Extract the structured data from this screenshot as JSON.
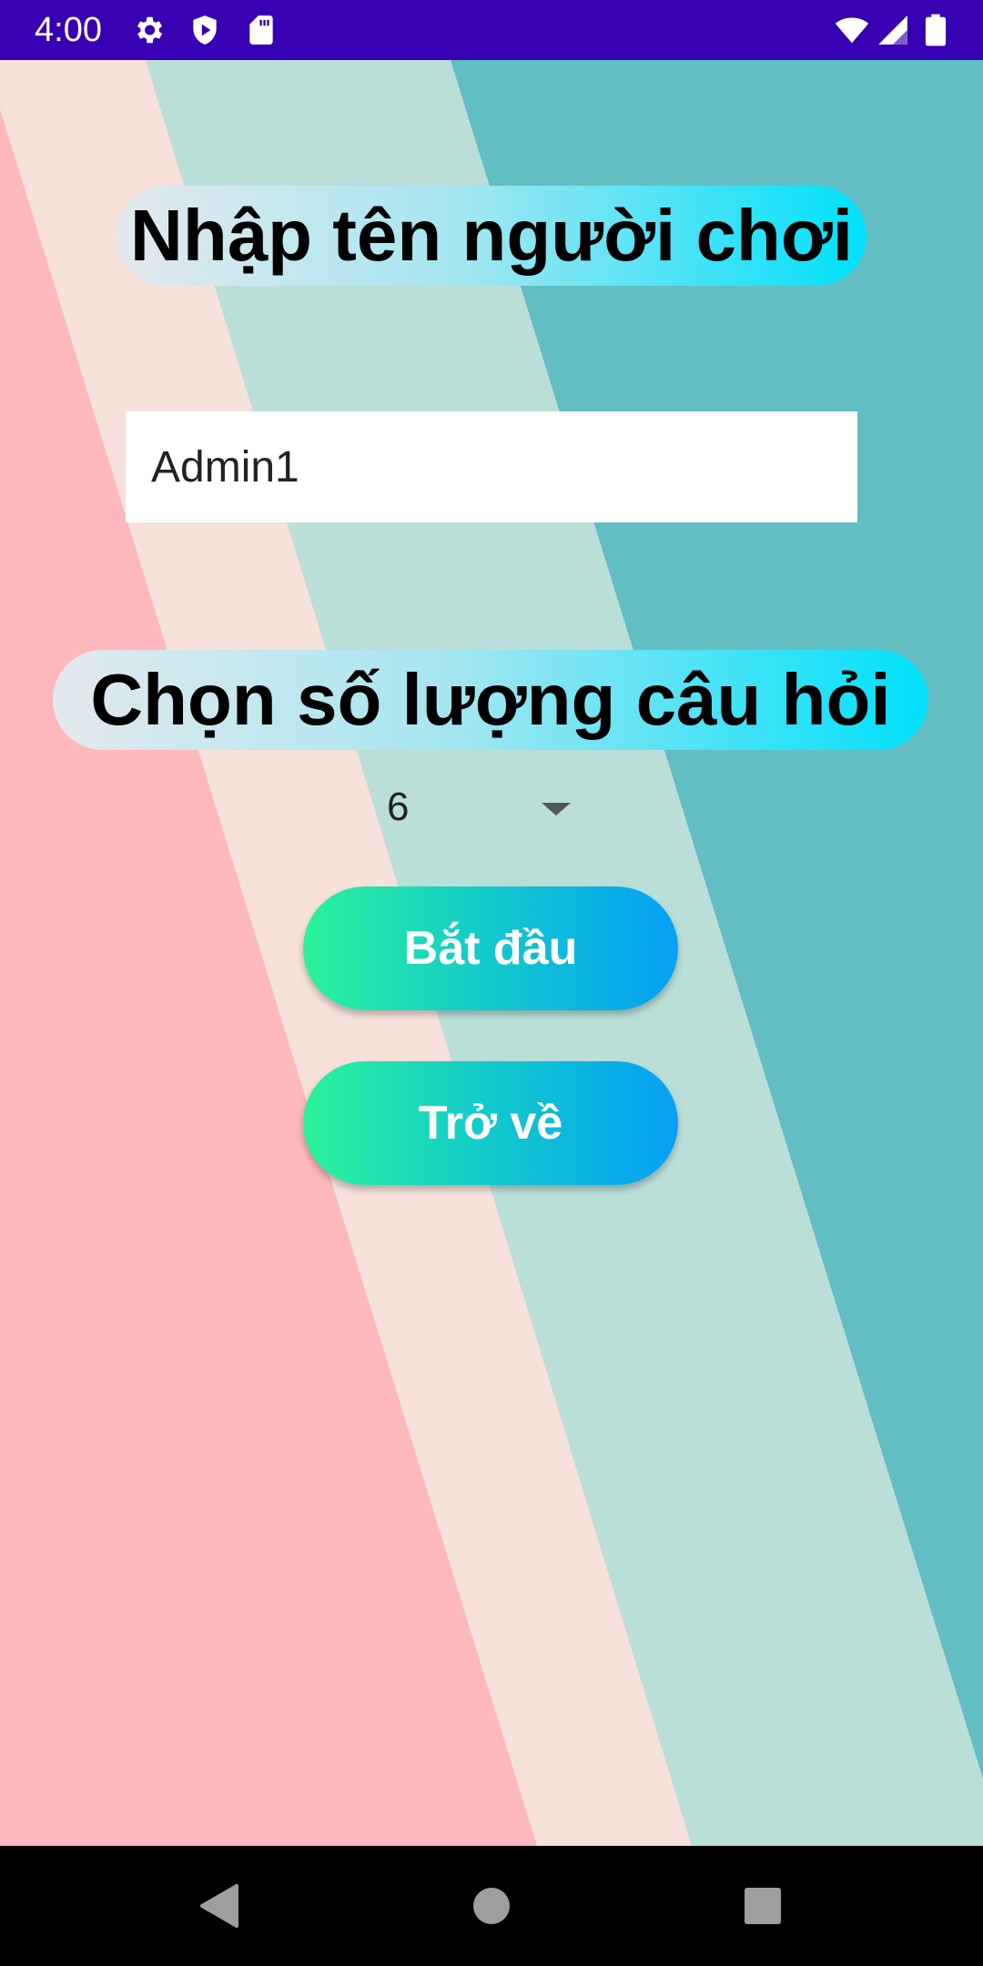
{
  "status_bar": {
    "time": "4:00",
    "left_icons": [
      "settings-icon",
      "shield-play-icon",
      "sd-card-icon"
    ],
    "right_icons": [
      "wifi-icon",
      "signal-icon",
      "battery-icon"
    ],
    "background": "#3700b3"
  },
  "screen": {
    "player_name_title": "Nhập tên người chơi",
    "player_name_value": "Admin1",
    "question_count_title": "Chọn số lượng câu hỏi",
    "question_count_value": "6",
    "start_button": "Bắt đầu",
    "back_button": "Trở về"
  },
  "nav_bar": {
    "back": "back-icon",
    "home": "home-icon",
    "recents": "recents-icon"
  },
  "colors": {
    "stripe_pink": "#fdb8bb",
    "stripe_cream": "#f6e1db",
    "stripe_mint": "#badfd9",
    "stripe_teal": "#62bec2",
    "button_gradient_start": "#2bf29b",
    "button_gradient_end": "#05a0f5",
    "title_gradient_end": "#00e0fb"
  }
}
